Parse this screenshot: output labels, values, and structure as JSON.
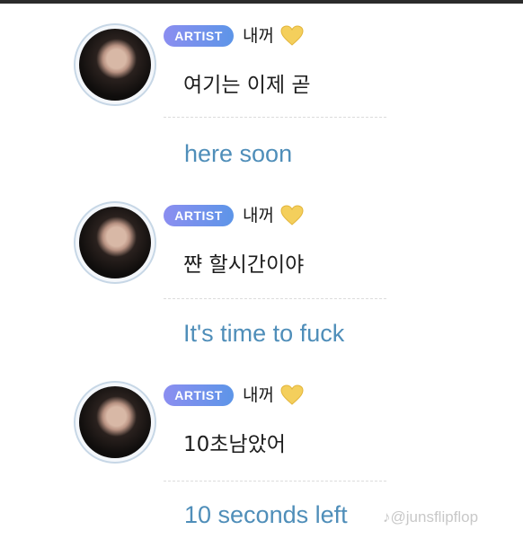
{
  "messages": [
    {
      "badge": "ARTIST",
      "name": "내꺼",
      "original": "여기는 이제 곧",
      "translation": "here soon"
    },
    {
      "badge": "ARTIST",
      "name": "내꺼",
      "original": "쨘 할시간이야",
      "translation": "It's time to fuck"
    },
    {
      "badge": "ARTIST",
      "name": "내꺼",
      "original": "10초남았어",
      "translation": "10 seconds left"
    }
  ],
  "heart_icon": "yellow-heart-icon",
  "colors": {
    "badge_start": "#8b8ef0",
    "badge_end": "#5d95e8",
    "translation": "#4f8eb9",
    "heart": "#f4cf5c"
  },
  "watermark": "@junsflipflop"
}
